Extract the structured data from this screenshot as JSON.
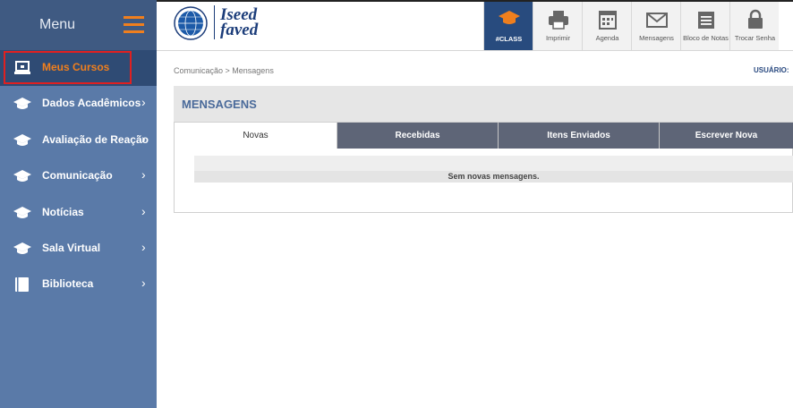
{
  "sidebar": {
    "menu_title": "Menu",
    "items": [
      {
        "label": "Meus Cursos",
        "icon": "laptop-icon"
      },
      {
        "label": "Dados Acadêmicos",
        "icon": "graduation-cap-icon"
      },
      {
        "label": "Avaliação de Reação",
        "icon": "graduation-cap-icon"
      },
      {
        "label": "Comunicação",
        "icon": "graduation-cap-icon"
      },
      {
        "label": "Notícias",
        "icon": "graduation-cap-icon"
      },
      {
        "label": "Sala Virtual",
        "icon": "graduation-cap-icon"
      },
      {
        "label": "Biblioteca",
        "icon": "book-icon"
      }
    ]
  },
  "logo": {
    "line1": "Iseed",
    "line2": "faved"
  },
  "toolbar": [
    {
      "label": "#CLASS",
      "icon": "graduation-cap-icon"
    },
    {
      "label": "Imprimir",
      "icon": "printer-icon"
    },
    {
      "label": "Agenda",
      "icon": "calendar-icon"
    },
    {
      "label": "Mensagens",
      "icon": "envelope-icon"
    },
    {
      "label": "Bloco de Notas",
      "icon": "notepad-icon"
    },
    {
      "label": "Trocar Senha",
      "icon": "lock-icon"
    }
  ],
  "breadcrumb": "Comunicação > Mensagens",
  "user_label": "USUÁRIO:",
  "panel": {
    "title": "MENSAGENS",
    "tabs": [
      "Novas",
      "Recebidas",
      "Itens Enviados",
      "Escrever Nova"
    ],
    "empty_message": "Sem novas mensagens."
  },
  "colors": {
    "accent": "#f07f1d",
    "sidebar": "#5a7aa8",
    "sidebar_dark": "#3f5a82",
    "brand_blue": "#284b7e",
    "highlight": "#e02020"
  }
}
